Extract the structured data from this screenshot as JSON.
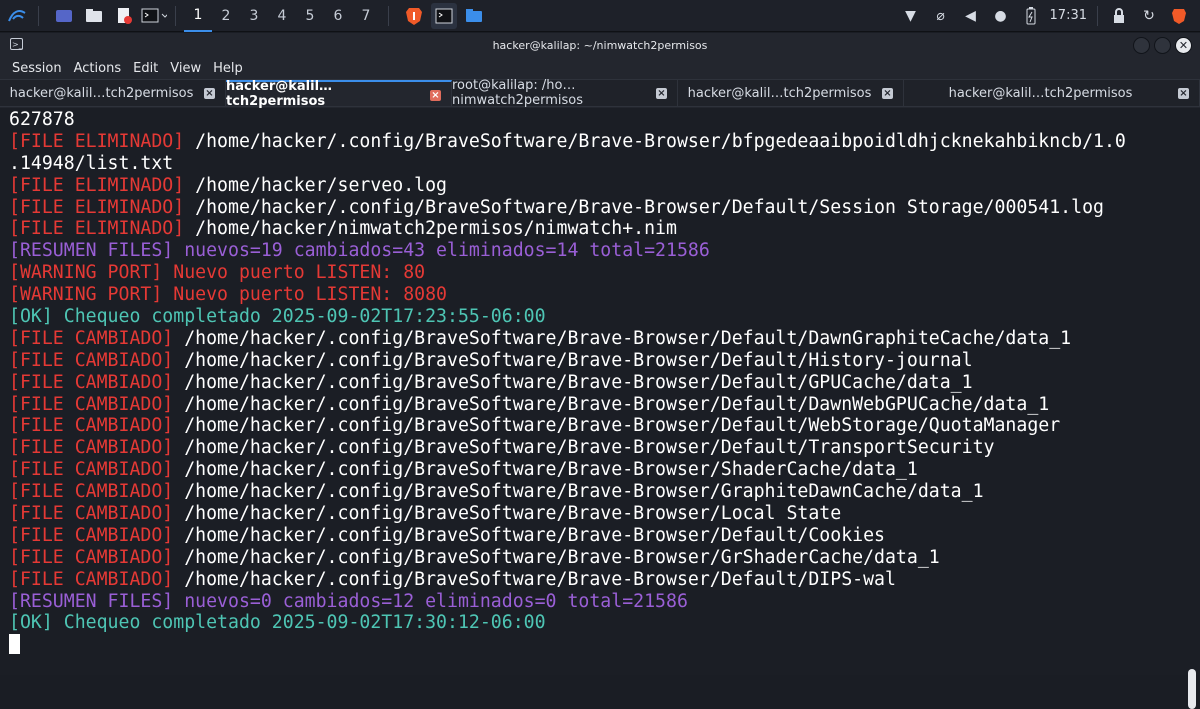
{
  "taskbar": {
    "workspaces": [
      "1",
      "2",
      "3",
      "4",
      "5",
      "6",
      "7"
    ],
    "active_workspace": "1",
    "clock": "17:31",
    "icons": [
      "kali-menu-icon",
      "desktop-icon",
      "file-manager-icon",
      "text-editor-icon",
      "terminal-icon",
      "brave-browser-icon",
      "terminal-task-icon",
      "folder-task-icon",
      "wifi-icon",
      "attachment-icon",
      "volume-icon",
      "bell-icon",
      "battery-icon",
      "lock-icon",
      "refresh-icon",
      "brave-tray-icon"
    ]
  },
  "window": {
    "title": "hacker@kalilap: ~/nimwatch2permisos",
    "menu": [
      "Session",
      "Actions",
      "Edit",
      "View",
      "Help"
    ],
    "tabs": [
      {
        "label": "hacker@kalil…tch2permisos",
        "active": false
      },
      {
        "label": "hacker@kalil…tch2permisos",
        "active": true
      },
      {
        "label": "root@kalilap: /ho…nimwatch2permisos",
        "active": false
      },
      {
        "label": "hacker@kalil…tch2permisos",
        "active": false
      },
      {
        "label": "hacker@kalil…tch2permisos",
        "active": false
      }
    ]
  },
  "terminal": {
    "lines": [
      {
        "tag": "",
        "text": "627878",
        "color": "white"
      },
      {
        "tag": "[FILE ELIMINADO]",
        "text": " /home/hacker/.config/BraveSoftware/Brave-Browser/bfpgedeaaibpoidldhjcknekahbikncb/1.0",
        "color": "red"
      },
      {
        "tag": "",
        "text": ".14948/list.txt",
        "color": "white"
      },
      {
        "tag": "[FILE ELIMINADO]",
        "text": " /home/hacker/serveo.log",
        "color": "red"
      },
      {
        "tag": "[FILE ELIMINADO]",
        "text": " /home/hacker/.config/BraveSoftware/Brave-Browser/Default/Session Storage/000541.log",
        "color": "red"
      },
      {
        "tag": "[FILE ELIMINADO]",
        "text": " /home/hacker/nimwatch2permisos/nimwatch+.nim",
        "color": "red"
      },
      {
        "tag": "[RESUMEN FILES] nuevos=19 cambiados=43 eliminados=14 total=21586",
        "text": "",
        "color": "purple"
      },
      {
        "tag": "[WARNING PORT] Nuevo puerto LISTEN: 80",
        "text": "",
        "color": "red"
      },
      {
        "tag": "[WARNING PORT] Nuevo puerto LISTEN: 8080",
        "text": "",
        "color": "red"
      },
      {
        "tag": "[OK] Chequeo completado 2025-09-02T17:23:55-06:00",
        "text": "",
        "color": "cyan"
      },
      {
        "tag": "[FILE CAMBIADO]",
        "text": " /home/hacker/.config/BraveSoftware/Brave-Browser/Default/DawnGraphiteCache/data_1",
        "color": "red"
      },
      {
        "tag": "[FILE CAMBIADO]",
        "text": " /home/hacker/.config/BraveSoftware/Brave-Browser/Default/History-journal",
        "color": "red"
      },
      {
        "tag": "[FILE CAMBIADO]",
        "text": " /home/hacker/.config/BraveSoftware/Brave-Browser/Default/GPUCache/data_1",
        "color": "red"
      },
      {
        "tag": "[FILE CAMBIADO]",
        "text": " /home/hacker/.config/BraveSoftware/Brave-Browser/Default/DawnWebGPUCache/data_1",
        "color": "red"
      },
      {
        "tag": "[FILE CAMBIADO]",
        "text": " /home/hacker/.config/BraveSoftware/Brave-Browser/Default/WebStorage/QuotaManager",
        "color": "red"
      },
      {
        "tag": "[FILE CAMBIADO]",
        "text": " /home/hacker/.config/BraveSoftware/Brave-Browser/Default/TransportSecurity",
        "color": "red"
      },
      {
        "tag": "[FILE CAMBIADO]",
        "text": " /home/hacker/.config/BraveSoftware/Brave-Browser/ShaderCache/data_1",
        "color": "red"
      },
      {
        "tag": "[FILE CAMBIADO]",
        "text": " /home/hacker/.config/BraveSoftware/Brave-Browser/GraphiteDawnCache/data_1",
        "color": "red"
      },
      {
        "tag": "[FILE CAMBIADO]",
        "text": " /home/hacker/.config/BraveSoftware/Brave-Browser/Local State",
        "color": "red"
      },
      {
        "tag": "[FILE CAMBIADO]",
        "text": " /home/hacker/.config/BraveSoftware/Brave-Browser/Default/Cookies",
        "color": "red"
      },
      {
        "tag": "[FILE CAMBIADO]",
        "text": " /home/hacker/.config/BraveSoftware/Brave-Browser/GrShaderCache/data_1",
        "color": "red"
      },
      {
        "tag": "[FILE CAMBIADO]",
        "text": " /home/hacker/.config/BraveSoftware/Brave-Browser/Default/DIPS-wal",
        "color": "red"
      },
      {
        "tag": "[RESUMEN FILES] nuevos=0 cambiados=12 eliminados=0 total=21586",
        "text": "",
        "color": "purple"
      },
      {
        "tag": "[OK] Chequeo completado 2025-09-02T17:30:12-06:00",
        "text": "",
        "color": "cyan"
      }
    ]
  },
  "colors": {
    "red": "#e53935",
    "purple": "#9a5fd6",
    "cyan": "#4ec5b4",
    "accent": "#3b8eea",
    "terminal_bg": "#1b1e25"
  }
}
